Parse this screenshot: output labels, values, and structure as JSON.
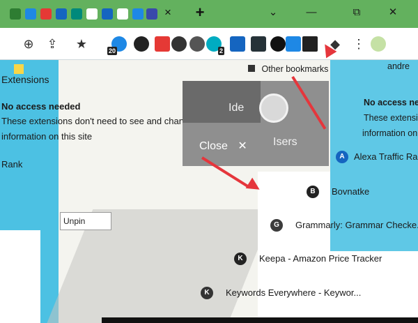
{
  "tabstrip": {
    "tab_close": "×",
    "new_tab": "+",
    "win_chevron": "⌄",
    "win_minimize": "—",
    "win_restore": "⧉",
    "win_close": "✕"
  },
  "toolbar": {
    "zoom_icon": "⊕",
    "share_icon": "⇪",
    "star_icon": "★",
    "badge_20": "20",
    "badge_2": "2",
    "puzzle_icon": "◆",
    "menu_icon": "⋮",
    "profile_name": "andre"
  },
  "bookmarks": {
    "other_bookmarks": "Other bookmarks"
  },
  "left": {
    "extensions_label": "Extensions",
    "no_access_heading": "No access needed",
    "no_access_desc_line1": "These extensions don't need to see and change",
    "no_access_desc_line2": "information on this site",
    "rank_fragment": "Rank",
    "unpin_fragment": "Unpin"
  },
  "grey_overlay": {
    "frag_ide": "Ide",
    "frag_users": "Isers",
    "close_label": "Close",
    "close_icon": "✕"
  },
  "extensions_list": [
    {
      "icon": "A",
      "label": "Alexa Traffic Rank"
    },
    {
      "icon": "B",
      "label": "Bovnatke"
    },
    {
      "icon": "G",
      "label": "Grammarly: Grammar Checke..."
    },
    {
      "icon": "K",
      "label": "Keepa - Amazon Price Tracker"
    },
    {
      "icon": "K",
      "label": "Keywords Everywhere - Keywor..."
    }
  ],
  "right_info": {
    "heading": "No access needed",
    "line1": "These extensions don't need to see and change",
    "line2": "information on this site"
  },
  "colors": {
    "tabstrip_green": "#63b15e",
    "page_cyan": "#5fc8e6",
    "arrow_red": "#e5363c",
    "overlay_grey": "#8f8f8f"
  }
}
